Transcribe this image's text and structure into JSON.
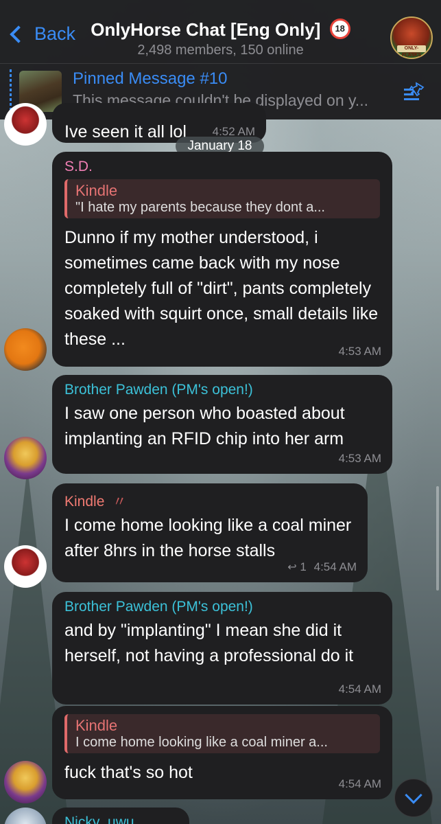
{
  "header": {
    "back_label": "Back",
    "title": "OnlyHorse Chat [Eng Only]",
    "age_badge": "18",
    "subtitle": "2,498 members, 150 online",
    "group_avatar_text": "ONLY-FLASKS"
  },
  "pinned": {
    "title": "Pinned Message #10",
    "text": "This message couldn't be displayed on y..."
  },
  "date_separator": "January 18",
  "messages": [
    {
      "text": "Ive seen it all lol",
      "time": "4:52 AM"
    },
    {
      "sender": "S.D.",
      "sender_color": "#f07fb4",
      "reply_name": "Kindle",
      "reply_text": "\"I hate my parents because they dont a...",
      "text": "Dunno if my mother understood, i sometimes came back with my nose completely full of \"dirt\", pants completely soaked with squirt once, small details like these ...",
      "time": "4:53 AM"
    },
    {
      "sender": "Brother Pawden (PM's open!)",
      "sender_color": "#3cc1d8",
      "text": "I saw one person who boasted about implanting an RFID chip into her arm",
      "time": "4:53 AM"
    },
    {
      "sender": "Kindle",
      "sender_color": "#f07a72",
      "text": "I come home looking like a coal miner after 8hrs in the horse stalls",
      "reply_count": "1",
      "time": "4:54 AM"
    },
    {
      "sender": "Brother Pawden (PM's open!)",
      "sender_color": "#3cc1d8",
      "text": "and by \"implanting\" I mean she did it herself, not having a professional do it",
      "time": "4:54 AM"
    },
    {
      "reply_name": "Kindle",
      "reply_text": "I come home looking like a coal miner a...",
      "text": "fuck that's so hot",
      "time": "4:54 AM"
    },
    {
      "sender": "Nicky_uwu",
      "sender_color": "#3cc1d8"
    }
  ]
}
